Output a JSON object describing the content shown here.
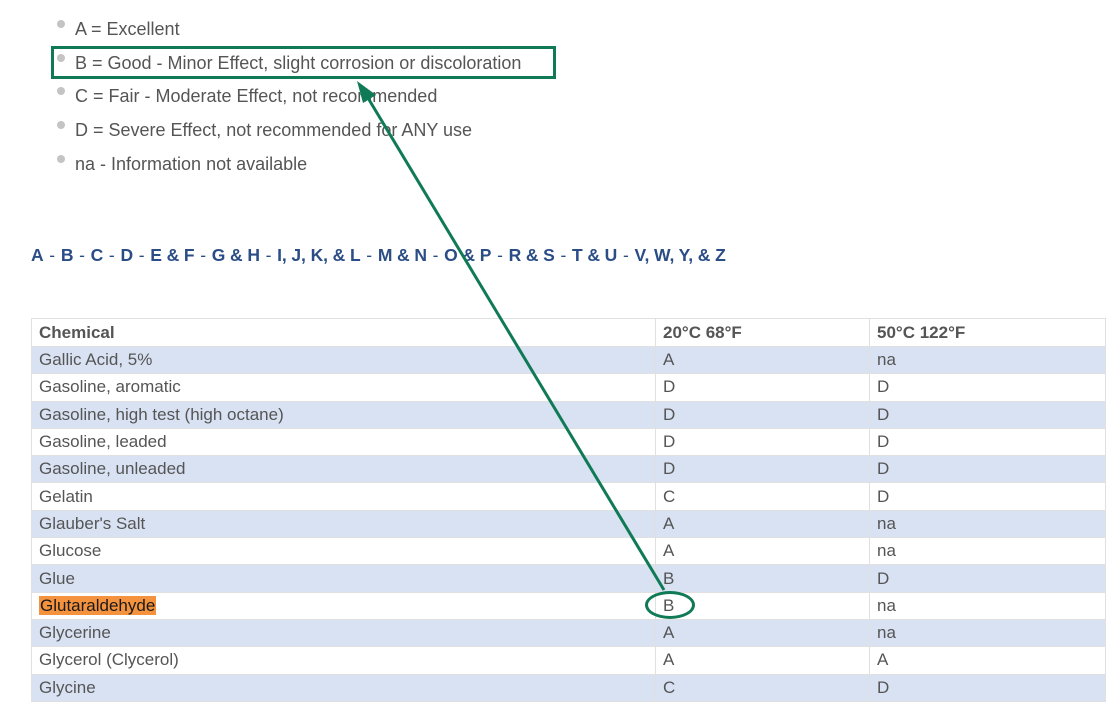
{
  "legend": {
    "items": [
      {
        "text": "A = Excellent"
      },
      {
        "text": "B = Good - Minor Effect, slight corrosion or discoloration"
      },
      {
        "text": "C = Fair - Moderate Effect, not recommended"
      },
      {
        "text": "D = Severe Effect, not recommended for ANY use"
      },
      {
        "text": "na - Information not available"
      }
    ]
  },
  "nav": {
    "links": [
      "A",
      "B",
      "C",
      "D",
      "E & F",
      "G & H",
      "I, J, K, & L",
      "M & N",
      "O & P",
      "R & S",
      "T & U",
      "V, W, Y, & Z"
    ],
    "separator": " - "
  },
  "table": {
    "headers": [
      "Chemical",
      "20°C 68°F",
      "50°C 122°F"
    ],
    "rows": [
      [
        "Gallic Acid, 5%",
        "A",
        "na"
      ],
      [
        "Gasoline, aromatic",
        "D",
        "D"
      ],
      [
        "Gasoline, high test (high octane)",
        "D",
        "D"
      ],
      [
        "Gasoline, leaded",
        "D",
        "D"
      ],
      [
        "Gasoline, unleaded",
        "D",
        "D"
      ],
      [
        "Gelatin",
        "C",
        "D"
      ],
      [
        "Glauber's Salt",
        "A",
        "na"
      ],
      [
        "Glucose",
        "A",
        "na"
      ],
      [
        "Glue",
        "B",
        "D"
      ],
      [
        "Glutaraldehyde",
        "B",
        "na"
      ],
      [
        "Glycerine",
        "A",
        "na"
      ],
      [
        "Glycerol (Clycerol)",
        "A",
        "A"
      ],
      [
        "Glycine",
        "C",
        "D"
      ]
    ],
    "highlighted_row": "Glutaraldehyde"
  },
  "colors": {
    "annotation": "#0f7a55",
    "link": "#2b4d86",
    "row_stripe": "#d9e2f3",
    "highlight": "#f5923e"
  }
}
